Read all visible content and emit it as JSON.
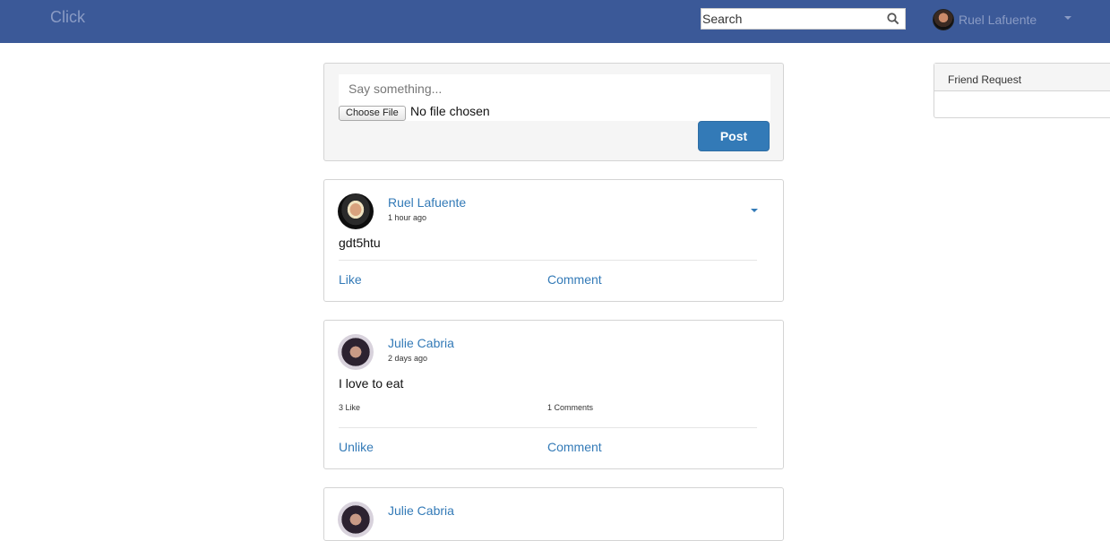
{
  "navbar": {
    "brand": "Click",
    "search_placeholder": "Search",
    "user_name": "Ruel Lafuente"
  },
  "composer": {
    "placeholder": "Say something...",
    "file_button": "Choose File",
    "file_status": "No file chosen",
    "post_button": "Post"
  },
  "posts": [
    {
      "author": "Ruel Lafuente",
      "time": "1 hour ago",
      "text": "gdt5htu",
      "like_label": "Like",
      "comment_label": "Comment"
    },
    {
      "author": "Julie Cabria",
      "time": "2 days ago",
      "text": "I love to eat",
      "like_count": "3 Like",
      "comment_count": "1 Comments",
      "like_label": "Unlike",
      "comment_label": "Comment"
    },
    {
      "author": "Julie Cabria"
    }
  ],
  "sidebar": {
    "friend_request_title": "Friend Request"
  },
  "colors": {
    "navbar": "#3b5998",
    "link": "#337ab7",
    "button": "#337ab7"
  }
}
